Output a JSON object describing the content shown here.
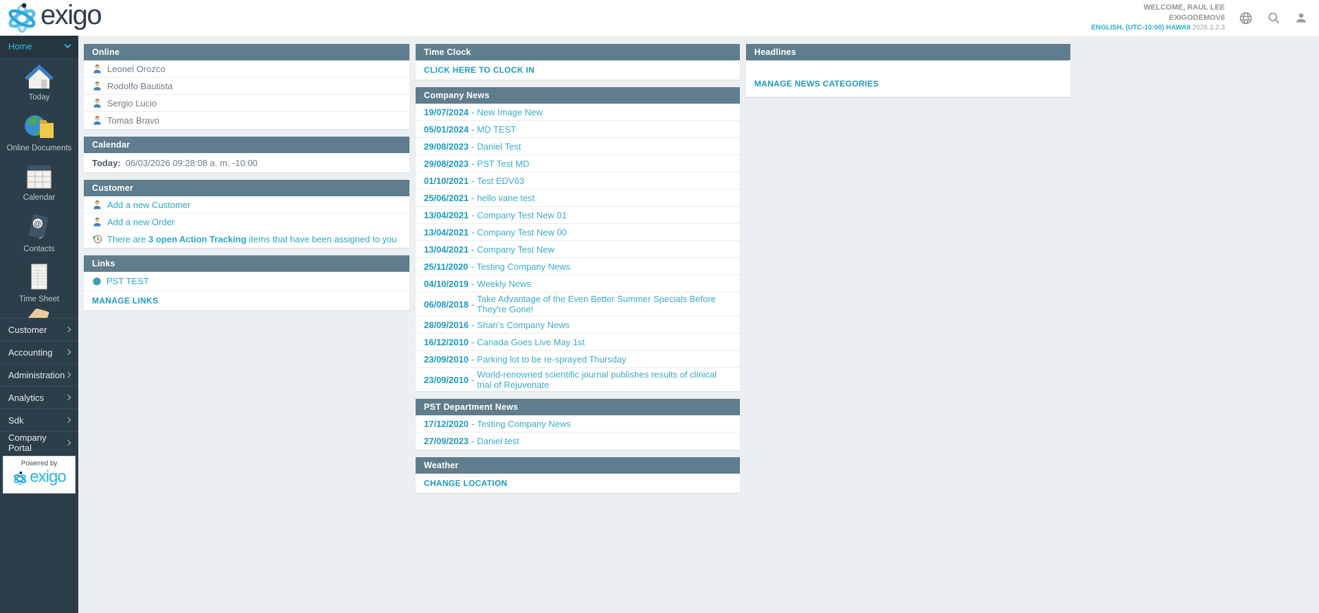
{
  "colors": {
    "accent": "#2aa7c7",
    "panel_header": "#5f7d8c",
    "sidebar": "#2c3e4a",
    "home_link": "#2bc0d4",
    "logo_dark": "#2e3d4d",
    "powered_cyan": "#2bb4e0"
  },
  "header": {
    "logo": "exigo",
    "welcome": "WELCOME, RAUL LEE",
    "account": "EXIGODEMOV6",
    "locale": "ENGLISH, (UTC-10:00) HAWAII",
    "version": "2026.3.2.3"
  },
  "sidebar": {
    "home": "Home",
    "icon_items": [
      "Today",
      "Online Documents",
      "Calendar",
      "Contacts",
      "Time Sheet"
    ],
    "menu_items": [
      "Customer",
      "Accounting",
      "Administration",
      "Analytics",
      "Sdk",
      "Company Portal"
    ],
    "powered_by": "Powered by",
    "powered_logo": "exigo"
  },
  "online": {
    "title": "Online",
    "users": [
      "Leonel Orozco",
      "Rodolfo Bautista",
      "Sergio Lucio",
      "Tomas Bravo"
    ]
  },
  "calendar": {
    "title": "Calendar",
    "today_label": "Today:",
    "today_value": "06/03/2026 09:28:08 a. m. -10:00"
  },
  "customer": {
    "title": "Customer",
    "links": [
      "Add a new Customer",
      "Add a new Order"
    ],
    "action_prefix": "There are ",
    "action_bold": "3 open Action Tracking",
    "action_suffix": " items that have been assigned to you"
  },
  "links": {
    "title": "Links",
    "item": "PST TEST",
    "manage": "MANAGE LINKS"
  },
  "time_clock": {
    "title": "Time Clock",
    "clock_in": "CLICK HERE TO CLOCK IN"
  },
  "company_news": {
    "title": "Company News",
    "separator": "-",
    "items": [
      {
        "date": "19/07/2024",
        "title": "New Image New"
      },
      {
        "date": "05/01/2024",
        "title": "MD TEST"
      },
      {
        "date": "29/08/2023",
        "title": "Daniel Test"
      },
      {
        "date": "29/08/2023",
        "title": "PST Test MD"
      },
      {
        "date": "01/10/2021",
        "title": "Test EDV63"
      },
      {
        "date": "25/06/2021",
        "title": "hello vane test"
      },
      {
        "date": "13/04/2021",
        "title": "Company Test New 01"
      },
      {
        "date": "13/04/2021",
        "title": "Company Test New 00"
      },
      {
        "date": "13/04/2021",
        "title": "Company Test New"
      },
      {
        "date": "25/11/2020",
        "title": "Testing Company News"
      },
      {
        "date": "04/10/2019",
        "title": "Weekly News"
      },
      {
        "date": "06/08/2018",
        "title": "Take Advantage of the Even Better Summer Specials Before They're Gone!"
      },
      {
        "date": "28/09/2016",
        "title": "Shan's Company News"
      },
      {
        "date": "16/12/2010",
        "title": "Canada Goes Live May 1st"
      },
      {
        "date": "23/09/2010",
        "title": "Parking lot to be re-sprayed Thursday"
      },
      {
        "date": "23/09/2010",
        "title": "World-renowned scientific journal publishes results of clinical trial of Rejuvenate"
      }
    ]
  },
  "pst_news": {
    "title": "PST Department News",
    "separator": "-",
    "items": [
      {
        "date": "17/12/2020",
        "title": "Testing Company News"
      },
      {
        "date": "27/09/2023",
        "title": "Daniel test"
      }
    ]
  },
  "weather": {
    "title": "Weather",
    "change_location": "CHANGE LOCATION"
  },
  "headlines": {
    "title": "Headlines",
    "manage": "MANAGE NEWS CATEGORIES"
  }
}
